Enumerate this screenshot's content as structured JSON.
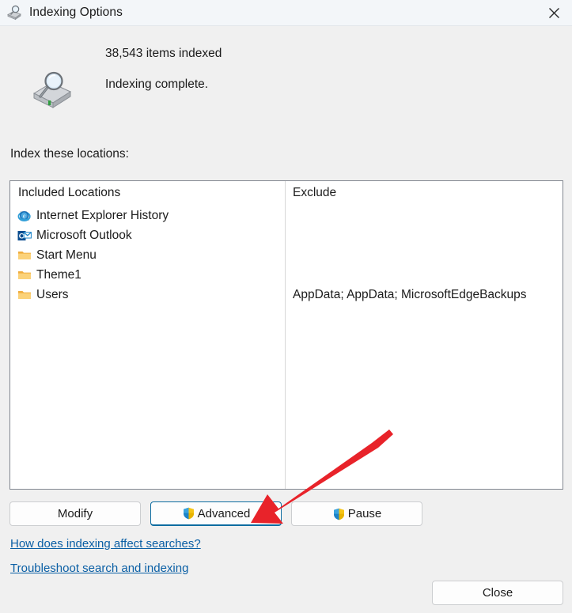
{
  "window": {
    "title": "Indexing Options",
    "title_icon": "indexing-options-icon",
    "close_icon": "close-icon"
  },
  "status": {
    "icon": "search-drive-icon",
    "items_indexed": "38,543 items indexed",
    "message": "Indexing complete."
  },
  "index_label": "Index these locations:",
  "listbox": {
    "headers": {
      "included": "Included Locations",
      "exclude": "Exclude"
    },
    "included_locations": [
      {
        "label": "Internet Explorer History",
        "icon": "internet-explorer-icon"
      },
      {
        "label": "Microsoft Outlook",
        "icon": "outlook-icon"
      },
      {
        "label": "Start Menu",
        "icon": "folder-icon"
      },
      {
        "label": "Theme1",
        "icon": "folder-icon"
      },
      {
        "label": "Users",
        "icon": "folder-icon"
      }
    ],
    "exclude_rows": [
      "",
      "",
      "",
      "",
      "AppData; AppData; MicrosoftEdgeBackups"
    ]
  },
  "buttons": {
    "modify": "Modify",
    "advanced": "Advanced",
    "pause": "Pause",
    "close": "Close",
    "shield_icon": "uac-shield-icon"
  },
  "links": {
    "how": "How does indexing affect searches?",
    "troubleshoot": "Troubleshoot search and indexing"
  },
  "annotation": {
    "arrow_color": "#e8232a",
    "arrow_target": "advanced-button"
  },
  "colors": {
    "link": "#0a5fa5",
    "focus_border": "#0d6ca0",
    "titlebar_bg": "#f3f6f9",
    "dialog_bg": "#f0f0f0",
    "folder": "#f7c563"
  }
}
